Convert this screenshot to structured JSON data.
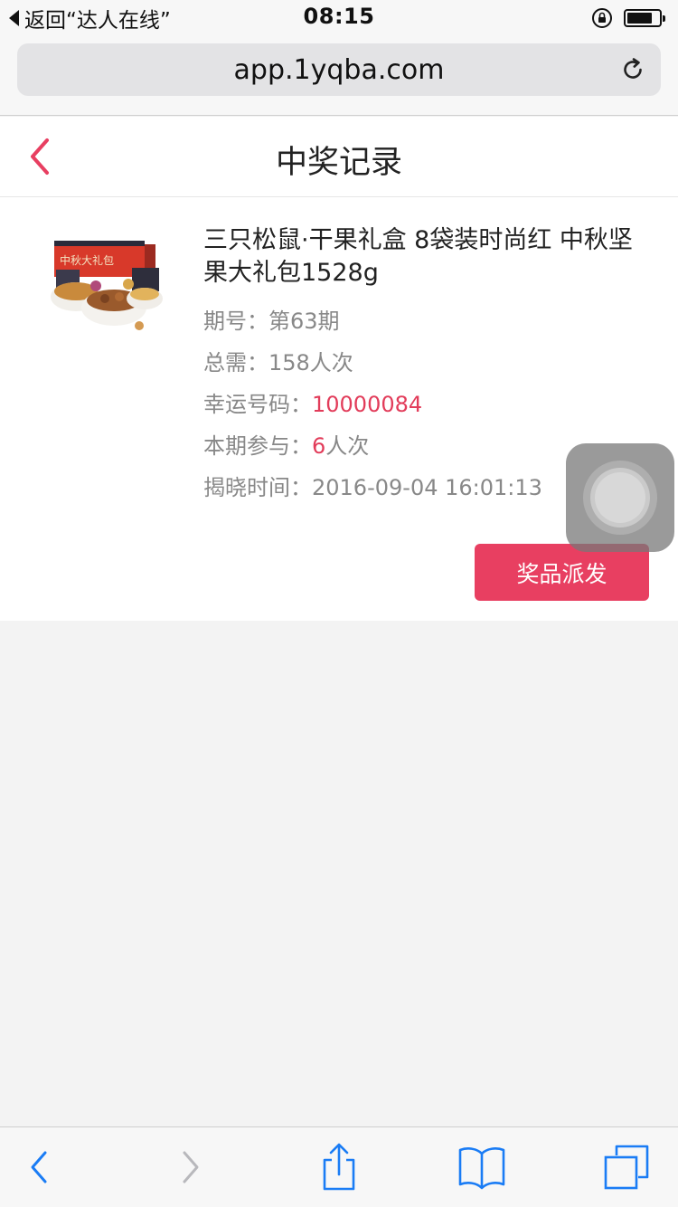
{
  "status_bar": {
    "back_label": "返回“达人在线”",
    "time": "08:15"
  },
  "browser": {
    "url": "app.1yqba.com"
  },
  "header": {
    "title": "中奖记录"
  },
  "record": {
    "product_title": "三只松鼠·干果礼盒 8袋装时尚红 中秋坚果大礼包1528g",
    "image_text": "中秋大礼包",
    "period_label": "期号：",
    "period_value": "第63期",
    "total_label": "总需：",
    "total_value": "158人次",
    "lucky_label": "幸运号码：",
    "lucky_value": "10000084",
    "joined_label": "本期参与：",
    "joined_count": "6",
    "joined_unit": "人次",
    "reveal_label": "揭晓时间：",
    "reveal_value": "2016-09-04 16:01:13",
    "button_label": "奖品派发"
  },
  "colors": {
    "accent": "#e83f61",
    "highlight_text": "#e23c5a",
    "ios_blue": "#1a7cf5",
    "page_bg": "#f3f3f3"
  },
  "icons": {
    "back": "chevron-left-icon",
    "reload": "reload-icon",
    "toolbar": [
      "chevron-left-icon",
      "chevron-right-icon",
      "share-icon",
      "bookmarks-icon",
      "tabs-icon"
    ]
  }
}
